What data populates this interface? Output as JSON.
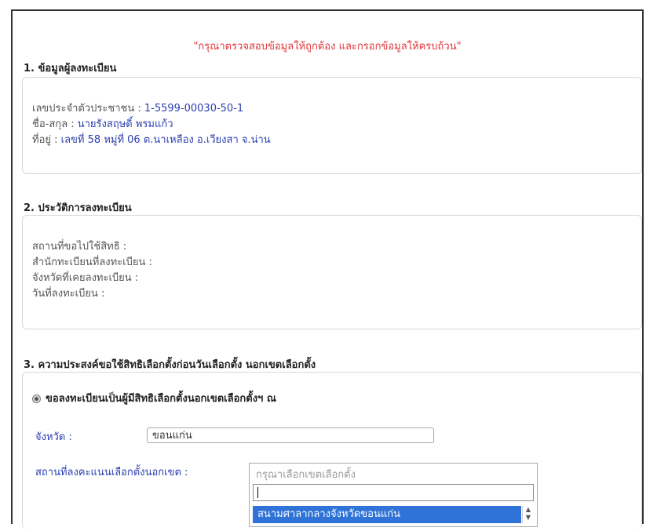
{
  "notice": "\"กรุณาตรวจสอบข้อมูลให้ถูกต้อง และกรอกข้อมูลให้ครบถ้วน\"",
  "section1": {
    "title": "1. ข้อมูลผู้ลงทะเบียน",
    "id_label": "เลขประจำตัวประชาชน : ",
    "id_value": "1-5599-00030-50-1",
    "name_label": "ชื่อ-สกุล : ",
    "name_value": "นายรังสฤษดิ์ พรมแก้ว",
    "address_label": "ที่อยู่ : ",
    "address_value": "เลขที่ 58 หมู่ที่ 06 ต.นาเหลือง อ.เวียงสา จ.น่าน"
  },
  "section2": {
    "title": "2. ประวัติการลงทะเบียน",
    "lines": [
      "สถานที่ขอไปใช้สิทธิ :",
      "สำนักทะเบียนที่ลงทะเบียน :",
      "จังหวัดที่เคยลงทะเบียน :",
      "วันที่ลงทะเบียน :"
    ]
  },
  "section3": {
    "title": "3. ความประสงค์ขอใช้สิทธิเลือกตั้งก่อนวันเลือกตั้ง นอกเขตเลือกตั้ง",
    "radio_label": "ขอลงทะเบียนเป็นผู้มีสิทธิเลือกตั้งนอกเขตเลือกตั้งฯ ณ",
    "province_label": "จังหวัด :",
    "province_value": "ขอนแก่น",
    "location_label": "สถานที่ลงคะแนนเลือกตั้งนอกเขต :",
    "location_placeholder": "กรุณาเลือกเขตเลือกตั้ง",
    "location_option": "สนามศาลากลางจังหวัดขอนแก่น"
  }
}
